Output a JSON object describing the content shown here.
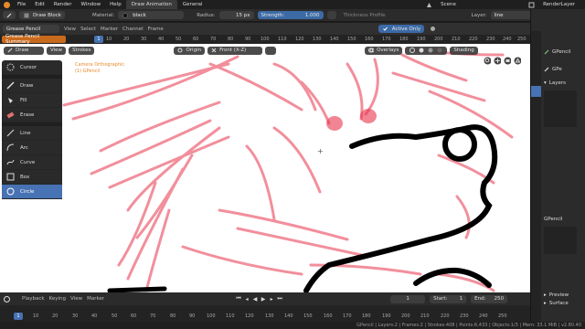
{
  "menubar": {
    "items": [
      "File",
      "Edit",
      "Render",
      "Window",
      "Help"
    ],
    "workspaces": [
      "Draw Animation",
      "General"
    ],
    "scene_label": "Scene",
    "renderlayer_label": "RenderLayer"
  },
  "toolbar": {
    "mode": "Draw",
    "brush": "Draw Block",
    "material_label": "Material:",
    "material_value": "black",
    "radius_label": "Radius:",
    "radius_value": "15 px",
    "strength_label": "Strength:",
    "strength_value": "1.000",
    "thickness_profile": "Thickness Profile",
    "layer_label": "Layer:",
    "layer_value": "line"
  },
  "dopesheet": {
    "mode": "Grease Pencil",
    "menus": [
      "View",
      "Select",
      "Marker",
      "Channel",
      "Frame"
    ],
    "active_only": "Active Only",
    "summary": "Grease Pencil Summary",
    "ticks": [
      "10",
      "20",
      "30",
      "40",
      "50",
      "60",
      "70",
      "80",
      "90",
      "100",
      "110",
      "120",
      "130",
      "140",
      "150",
      "160",
      "170",
      "180",
      "190",
      "200",
      "210",
      "220",
      "230",
      "240",
      "250"
    ],
    "current_frame": "1"
  },
  "viewport": {
    "mode": "Draw",
    "menus": [
      "View",
      "Strokes"
    ],
    "origin": "Origin",
    "view": "Front (X-Z)",
    "overlays": "Overlays",
    "shading": "Shading",
    "camera_label": "Camera Orthographic",
    "object_label": "(1) GPencil"
  },
  "tools": [
    {
      "label": "Cursor",
      "icon": "cursor-icon",
      "active": false
    },
    {
      "label": "Draw",
      "icon": "draw-icon",
      "active": false
    },
    {
      "label": "Fill",
      "icon": "fill-icon",
      "active": false
    },
    {
      "label": "Erase",
      "icon": "erase-icon",
      "active": false
    },
    {
      "label": "Line",
      "icon": "line-icon",
      "active": false
    },
    {
      "label": "Arc",
      "icon": "arc-icon",
      "active": false
    },
    {
      "label": "Curve",
      "icon": "curve-icon",
      "active": false
    },
    {
      "label": "Box",
      "icon": "box-icon",
      "active": false
    },
    {
      "label": "Circle",
      "icon": "circle-icon",
      "active": true
    }
  ],
  "rightpanel": {
    "object_name": "GPencil",
    "data_name": "GPe",
    "layers_label": "Layers",
    "materials_object": "GPencil",
    "preview": "Preview",
    "surface": "Surface"
  },
  "timeline": {
    "menus": [
      "Playback",
      "Keying",
      "View",
      "Marker"
    ],
    "frame": "1",
    "start_label": "Start:",
    "start_value": "1",
    "end_label": "End:",
    "end_value": "250",
    "ticks": [
      "10",
      "20",
      "30",
      "40",
      "50",
      "60",
      "70",
      "80",
      "90",
      "100",
      "110",
      "120",
      "130",
      "140",
      "150",
      "160",
      "170",
      "180",
      "190",
      "200",
      "210",
      "220",
      "230",
      "240",
      "250"
    ]
  },
  "status": {
    "text": "GPencil | Layers:2 | Frames:2 | Strokes:408 | Points:6,433 | Objects:1/3 | Mem: 33.1 MiB | v2.80.40"
  },
  "colors": {
    "accent": "#4772b3",
    "grease_pencil_orange": "#c86a1c",
    "sketch_red": "#e8344c",
    "ink": "#000000"
  }
}
